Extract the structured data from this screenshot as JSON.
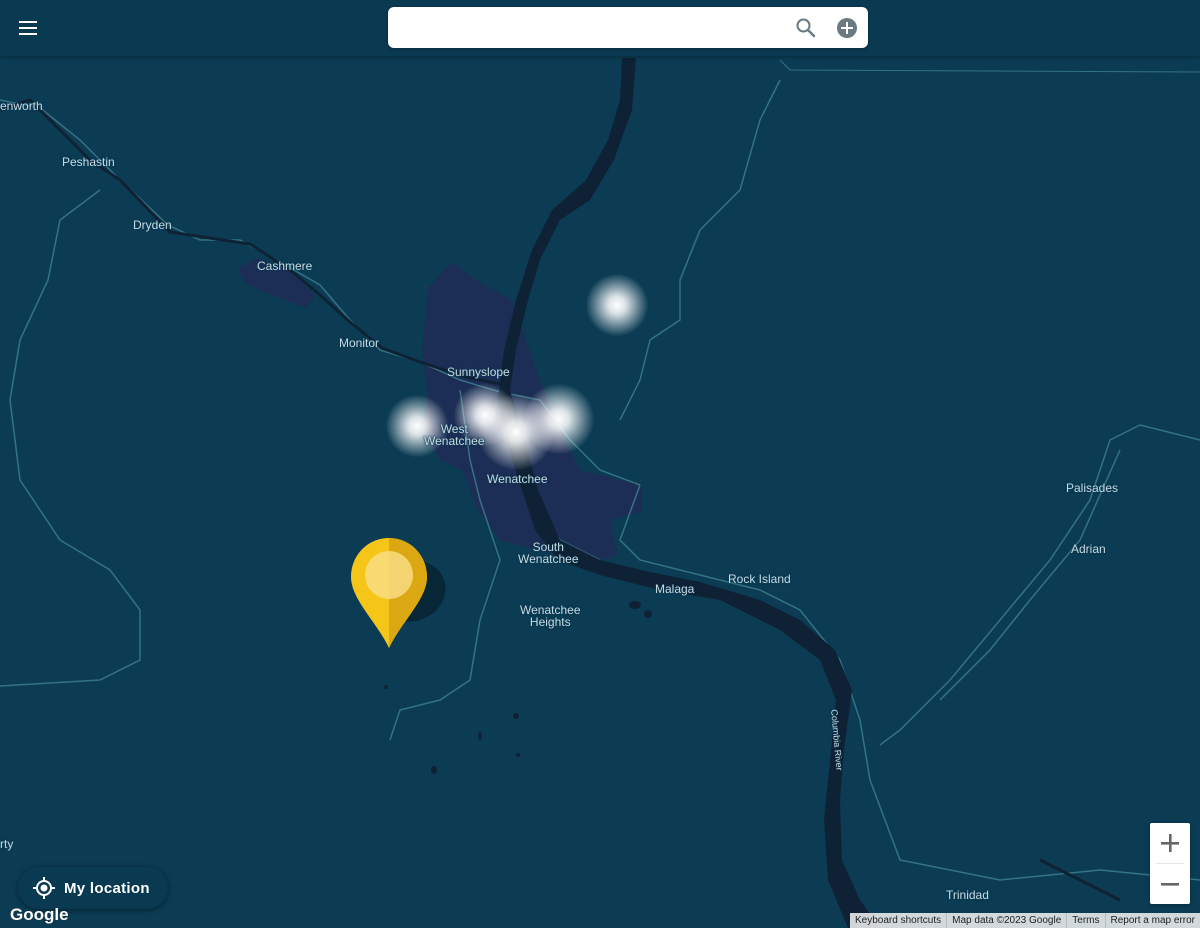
{
  "search": {
    "value": "",
    "placeholder": ""
  },
  "icons": {
    "menu": "menu-icon",
    "search": "search-icon",
    "add": "add-circle-icon",
    "my_location": "crosshair-icon",
    "zoom_in": "plus-icon",
    "zoom_out": "minus-icon",
    "pin": "map-pin-icon"
  },
  "colors": {
    "map_background": "#0b3c54",
    "water": "#0f2235",
    "urban": "#1c2e55",
    "roads": "#3c7d8c",
    "pin_fill": "#f5c518",
    "topbar": "#0a3a52"
  },
  "map_labels": [
    {
      "text": "enworth"
    },
    {
      "text": "Peshastin"
    },
    {
      "text": "Dryden"
    },
    {
      "text": "Cashmere"
    },
    {
      "text": "Monitor"
    },
    {
      "text": "Sunnyslope"
    },
    {
      "text": "West\nWenatchee"
    },
    {
      "text": "Wenatchee"
    },
    {
      "text": "South\nWenatchee"
    },
    {
      "text": "Malaga"
    },
    {
      "text": "Rock Island"
    },
    {
      "text": "Wenatchee\nHeights"
    },
    {
      "text": "Palisades"
    },
    {
      "text": "Adrian"
    },
    {
      "text": "Columbia River"
    },
    {
      "text": "Trinidad"
    },
    {
      "text": "rty"
    }
  ],
  "my_location_button": {
    "label": "My location"
  },
  "google_logo": {
    "text": "Google"
  },
  "attribution": {
    "keyboard_shortcuts": "Keyboard shortcuts",
    "map_data": "Map data ©2023 Google",
    "terms": "Terms",
    "report": "Report a map error"
  }
}
